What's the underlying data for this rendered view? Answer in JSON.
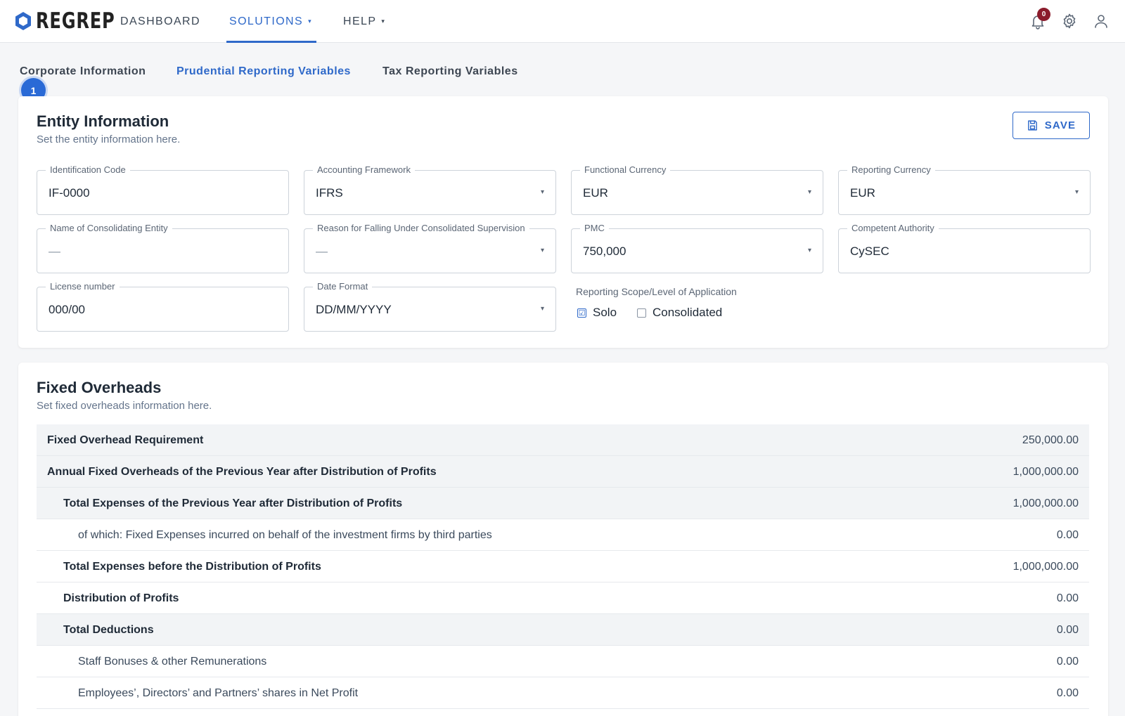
{
  "brand": {
    "name": "REGREP",
    "accent": "#2f69c9"
  },
  "nav": {
    "items": [
      {
        "label": "DASHBOARD",
        "active": false,
        "dropdown": false
      },
      {
        "label": "SOLUTIONS",
        "active": true,
        "dropdown": true
      },
      {
        "label": "HELP",
        "active": false,
        "dropdown": true
      }
    ],
    "caret": "▾",
    "notifications_count": "0",
    "icons": [
      "bell-icon",
      "gear-icon",
      "user-icon"
    ]
  },
  "tabs": [
    {
      "label": "Corporate Information",
      "active": false
    },
    {
      "label": "Prudential Reporting Variables",
      "active": true
    },
    {
      "label": "Tax Reporting Variables",
      "active": false
    }
  ],
  "step_badge": "1",
  "entity": {
    "title": "Entity Information",
    "subtitle": "Set the entity information here.",
    "save_label": "SAVE",
    "fields": {
      "identification_code": {
        "label": "Identification Code",
        "value": "IF-0000"
      },
      "accounting_framework": {
        "label": "Accounting Framework",
        "value": "IFRS"
      },
      "functional_currency": {
        "label": "Functional Currency",
        "value": "EUR"
      },
      "reporting_currency": {
        "label": "Reporting Currency",
        "value": "EUR"
      },
      "consolidating_entity": {
        "label": "Name of Consolidating Entity",
        "value": "—"
      },
      "consolidated_reason": {
        "label": "Reason for Falling Under Consolidated Supervision",
        "value": "—"
      },
      "pmc": {
        "label": "PMC",
        "value": "750,000"
      },
      "competent_authority": {
        "label": "Competent Authority",
        "value": "CySEC"
      },
      "license_number": {
        "label": "License number",
        "value": "000/00"
      },
      "date_format": {
        "label": "Date Format",
        "value": "DD/MM/YYYY"
      }
    },
    "scope": {
      "label": "Reporting Scope/Level of Application",
      "options": [
        {
          "label": "Solo",
          "checked": true
        },
        {
          "label": "Consolidated",
          "checked": false
        }
      ],
      "checked_glyph": "☑"
    }
  },
  "overheads": {
    "title": "Fixed Overheads",
    "subtitle": "Set fixed overheads information here.",
    "rows": [
      {
        "label": "Fixed Overhead Requirement",
        "value": "250,000.00"
      },
      {
        "label": "Annual Fixed Overheads of the Previous Year after Distribution of Profits",
        "value": "1,000,000.00"
      },
      {
        "label": "Total Expenses of the Previous Year after Distribution of Profits",
        "value": "1,000,000.00"
      },
      {
        "label": "of which: Fixed Expenses incurred on behalf of the investment firms by third parties",
        "value": "0.00"
      },
      {
        "label": "Total Expenses before the Distribution of Profits",
        "value": "1,000,000.00"
      },
      {
        "label": "Distribution of Profits",
        "value": "0.00"
      },
      {
        "label": "Total Deductions",
        "value": "0.00"
      },
      {
        "label": "Staff Bonuses & other Remunerations",
        "value": "0.00"
      },
      {
        "label": "Employees’, Directors’ and Partners’ shares in Net Profit",
        "value": "0.00"
      }
    ]
  }
}
